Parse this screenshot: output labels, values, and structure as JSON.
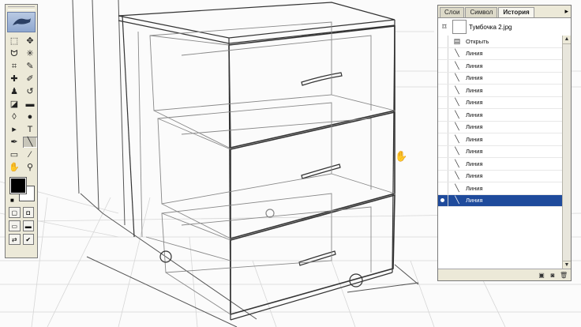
{
  "panel": {
    "tabs": [
      "Слои",
      "Символ",
      "История"
    ],
    "active_tab": "История",
    "snapshot_name": "Тумбочка 2.jpg",
    "history": [
      {
        "label": "Открыть",
        "icon": "open-icon"
      },
      {
        "label": "Линия",
        "icon": "line-icon"
      },
      {
        "label": "Линия",
        "icon": "line-icon"
      },
      {
        "label": "Линия",
        "icon": "line-icon"
      },
      {
        "label": "Линия",
        "icon": "line-icon"
      },
      {
        "label": "Линия",
        "icon": "line-icon"
      },
      {
        "label": "Линия",
        "icon": "line-icon"
      },
      {
        "label": "Линия",
        "icon": "line-icon"
      },
      {
        "label": "Линия",
        "icon": "line-icon"
      },
      {
        "label": "Линия",
        "icon": "line-icon"
      },
      {
        "label": "Линия",
        "icon": "line-icon"
      },
      {
        "label": "Линия",
        "icon": "line-icon"
      },
      {
        "label": "Линия",
        "icon": "line-icon"
      },
      {
        "label": "Линия",
        "icon": "line-icon"
      }
    ],
    "selected_state": "Линия"
  },
  "toolbox": {
    "tools": [
      {
        "name": "marquee-tool",
        "glyph": "⬚"
      },
      {
        "name": "move-tool",
        "glyph": "✥"
      },
      {
        "name": "lasso-tool",
        "glyph": "ᗢ"
      },
      {
        "name": "magic-wand-tool",
        "glyph": "✳"
      },
      {
        "name": "crop-tool",
        "glyph": "⌗"
      },
      {
        "name": "slice-tool",
        "glyph": "✎"
      },
      {
        "name": "healing-brush-tool",
        "glyph": "✚"
      },
      {
        "name": "brush-tool",
        "glyph": "✐"
      },
      {
        "name": "clone-stamp-tool",
        "glyph": "♟"
      },
      {
        "name": "history-brush-tool",
        "glyph": "↺"
      },
      {
        "name": "eraser-tool",
        "glyph": "◪"
      },
      {
        "name": "gradient-tool",
        "glyph": "▬"
      },
      {
        "name": "blur-tool",
        "glyph": "◊"
      },
      {
        "name": "dodge-tool",
        "glyph": "●"
      },
      {
        "name": "path-select-tool",
        "glyph": "▸"
      },
      {
        "name": "type-tool",
        "glyph": "T"
      },
      {
        "name": "pen-tool",
        "glyph": "✒"
      },
      {
        "name": "line-tool",
        "glyph": "╲"
      },
      {
        "name": "notes-tool",
        "glyph": "▭"
      },
      {
        "name": "eyedropper-tool",
        "glyph": "⁄"
      },
      {
        "name": "hand-tool",
        "glyph": "✋"
      },
      {
        "name": "zoom-tool",
        "glyph": "⚲"
      }
    ],
    "active_tool": "line-tool",
    "foreground_color": "#000000",
    "background_color": "#ffffff"
  },
  "colors": {
    "selection": "#1f4b9c",
    "panel_bg": "#ece9d8"
  }
}
